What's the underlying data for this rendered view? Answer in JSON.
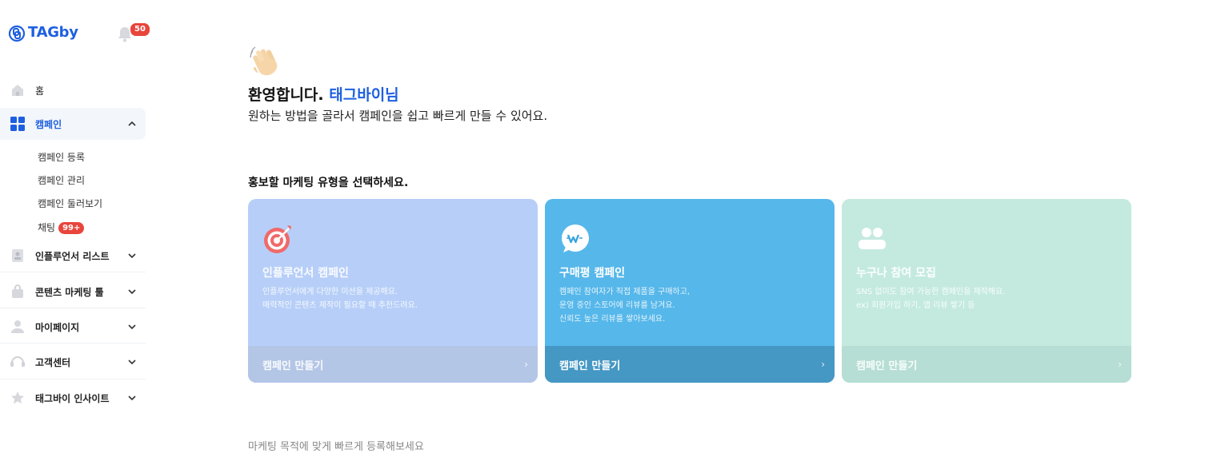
{
  "sidebar": {
    "logo_text": "TAGby",
    "notification_count": "50",
    "items": [
      {
        "label": "홈",
        "icon": "home-icon"
      },
      {
        "label": "캠페인",
        "icon": "grid-icon"
      },
      {
        "label": "인플루언서 리스트",
        "icon": "person-list-icon"
      },
      {
        "label": "콘텐츠 마케팅 툴",
        "icon": "bag-icon"
      },
      {
        "label": "마이페이지",
        "icon": "user-icon"
      },
      {
        "label": "고객센터",
        "icon": "headset-icon"
      },
      {
        "label": "태그바이 인사이트",
        "icon": "star-icon"
      }
    ],
    "campaign_sub": [
      "캠페인 등록",
      "캠페인 관리",
      "캠페인 둘러보기"
    ],
    "chat_label": "채팅",
    "chat_badge": "99+"
  },
  "main": {
    "welcome_prefix": "환영합니다.",
    "welcome_name": "태그바이님",
    "subtitle": "원하는 방법을 골라서 캠페인을 쉽고 빠르게 만들 수 있어요.",
    "section_title": "홍보할 마케팅 유형을 선택하세요.",
    "cards": [
      {
        "title": "인플루언서 캠페인",
        "desc": [
          "인플루언서에게 다양한 미션을 제공해요.",
          "매력적인 콘텐츠 제작이 필요할 때 추천드려요."
        ],
        "footer": "캠페인 만들기",
        "icon": "target-icon"
      },
      {
        "title": "구매평 캠페인",
        "desc": [
          "캠페인 참여자가 직접 제품을 구매하고,",
          "운영 중인 스토어에 리뷰를 남겨요.",
          "신뢰도 높은 리뷰를 쌓아보세요."
        ],
        "footer": "캠페인 만들기",
        "icon": "chat-w-icon"
      },
      {
        "title": "누구나 참여 모집",
        "desc": [
          "SNS 없이도 참여 가능한 캠페인을 제작해요.",
          "ex) 회원가입 하기, 앱 리뷰 쌓기 등"
        ],
        "footer": "캠페인 만들기",
        "icon": "people-icon"
      }
    ],
    "bottom_text": "마케팅 목적에 맞게 빠르게 등록해보세요"
  },
  "colors": {
    "brand": "#1e5fe0",
    "card1": "#b7cff8",
    "card2": "#56b7ea",
    "card3": "#c4eae0",
    "badge": "#e8453c"
  }
}
